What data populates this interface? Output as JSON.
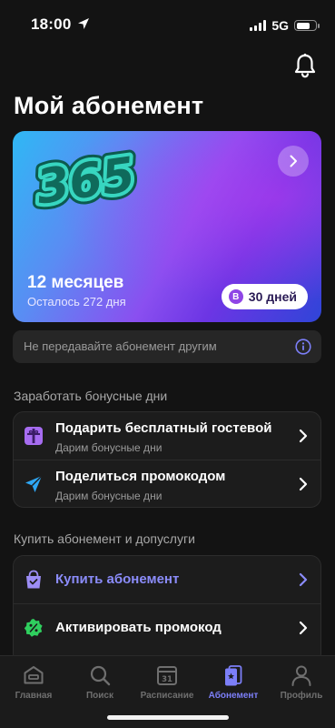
{
  "status_bar": {
    "time": "18:00",
    "network": "5G"
  },
  "header": {
    "title": "Мой абонемент"
  },
  "subscription_card": {
    "logo_text": "365",
    "period": "12 месяцев",
    "remaining": "Осталось 272 дня",
    "bonus_badge": "В",
    "bonus_days": "30 дней"
  },
  "notice": {
    "text": "Не передавайте абонемент другим"
  },
  "earn_section": {
    "title": "Заработать бонусные дни",
    "items": [
      {
        "title": "Подарить бесплатный гостевой",
        "subtitle": "Дарим бонусные дни",
        "icon": "gift-icon"
      },
      {
        "title": "Поделиться промокодом",
        "subtitle": "Дарим бонусные дни",
        "icon": "send-icon"
      }
    ]
  },
  "buy_section": {
    "title": "Купить абонемент и допуслуги",
    "items": [
      {
        "title": "Купить абонемент",
        "icon": "shopping-bag-icon"
      },
      {
        "title": "Активировать промокод",
        "icon": "percent-badge-icon"
      }
    ]
  },
  "tabbar": {
    "items": [
      {
        "label": "Главная",
        "icon": "home-icon"
      },
      {
        "label": "Поиск",
        "icon": "search-icon"
      },
      {
        "label": "Расписание",
        "icon": "calendar-icon",
        "icon_text": "31"
      },
      {
        "label": "Абонемент",
        "icon": "membership-card-icon",
        "active": true
      },
      {
        "label": "Профиль",
        "icon": "profile-icon"
      }
    ]
  },
  "colors": {
    "background": "#131313",
    "accent": "#7c7ff8",
    "accent_link": "#8b8cfa",
    "card_gradient": [
      "#2fb8f4",
      "#8a4ff0",
      "#2f45d8"
    ],
    "promo_green": "#2fcf5e"
  }
}
